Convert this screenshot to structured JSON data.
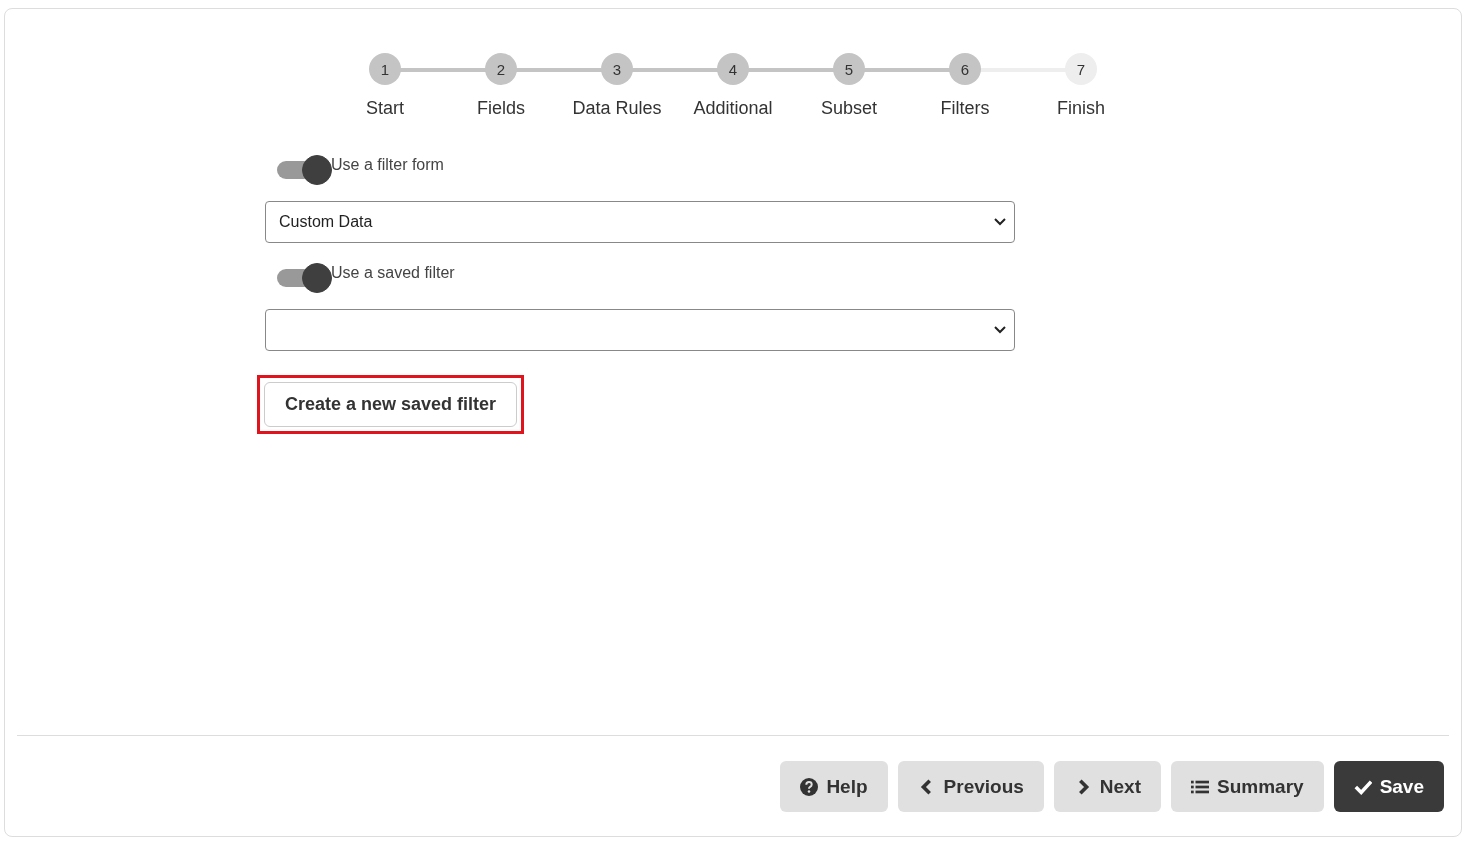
{
  "steps": [
    {
      "number": "1",
      "label": "Start",
      "done": true
    },
    {
      "number": "2",
      "label": "Fields",
      "done": true
    },
    {
      "number": "3",
      "label": "Data Rules",
      "done": true
    },
    {
      "number": "4",
      "label": "Additional",
      "done": true
    },
    {
      "number": "5",
      "label": "Subset",
      "done": true
    },
    {
      "number": "6",
      "label": "Filters",
      "done": true
    },
    {
      "number": "7",
      "label": "Finish",
      "done": false
    }
  ],
  "filter_form": {
    "toggle": {
      "label": "Use a filter form",
      "on": true
    },
    "select": {
      "value": "Custom Data"
    }
  },
  "saved_filter": {
    "toggle": {
      "label": "Use a saved filter",
      "on": true
    },
    "create_button": {
      "label": "Create a new saved filter",
      "highlighted": true
    }
  },
  "footer_buttons": [
    {
      "kind": "help",
      "label": "Help"
    },
    {
      "kind": "previous",
      "label": "Previous"
    },
    {
      "kind": "next",
      "label": "Next"
    },
    {
      "kind": "summary",
      "label": "Summary"
    },
    {
      "kind": "save",
      "label": "Save"
    }
  ]
}
